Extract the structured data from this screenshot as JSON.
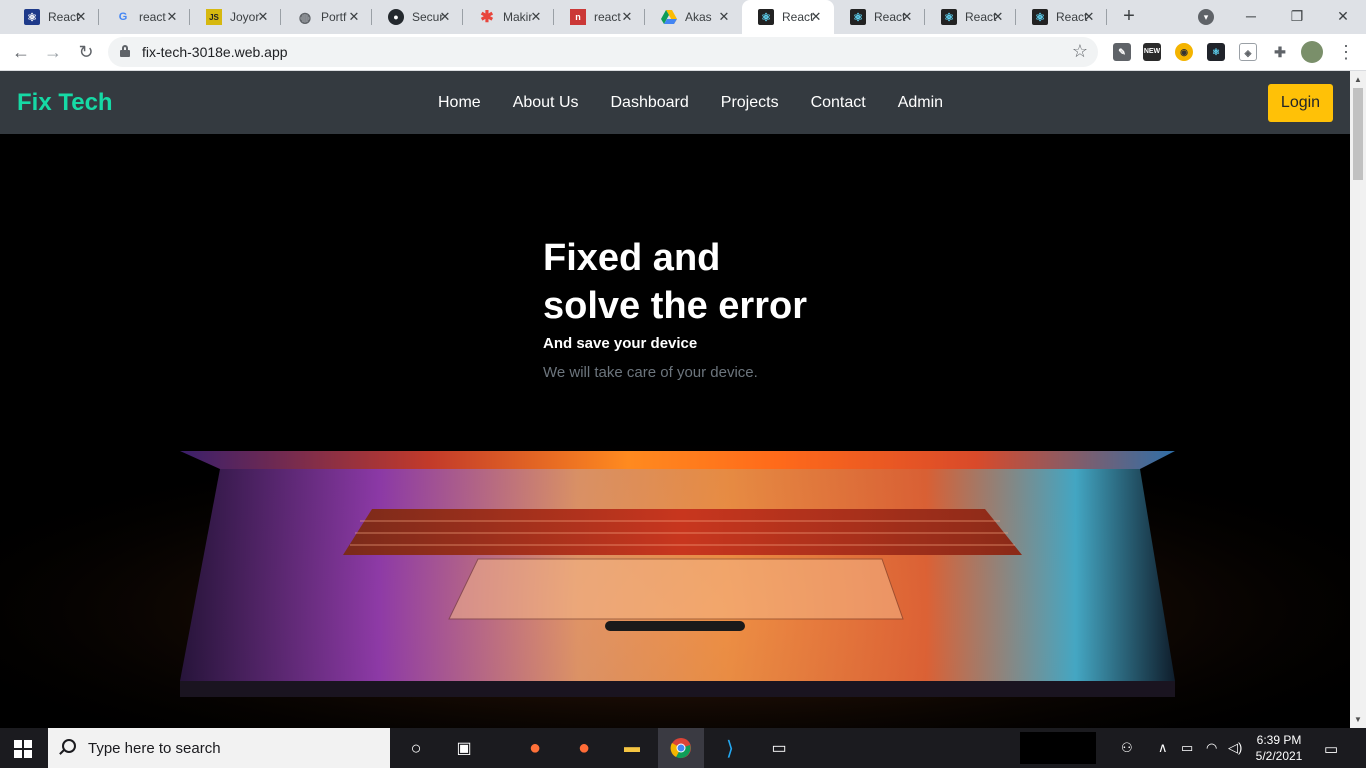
{
  "browser": {
    "tabs": [
      {
        "label": "React",
        "icon": "react-blue-icon",
        "active": false
      },
      {
        "label": "react",
        "icon": "google-icon",
        "active": false
      },
      {
        "label": "Joyor",
        "icon": "jsbin-icon",
        "active": false
      },
      {
        "label": "Portf",
        "icon": "globe-icon",
        "active": false
      },
      {
        "label": "Secur",
        "icon": "github-icon",
        "active": false
      },
      {
        "label": "Makir",
        "icon": "asterisk-icon",
        "active": false
      },
      {
        "label": "react",
        "icon": "npm-icon",
        "active": false
      },
      {
        "label": "Akas",
        "icon": "google-drive-icon",
        "active": false
      },
      {
        "label": "React",
        "icon": "react-icon",
        "active": true
      },
      {
        "label": "React",
        "icon": "react-icon",
        "active": false
      },
      {
        "label": "React",
        "icon": "react-icon",
        "active": false
      },
      {
        "label": "React",
        "icon": "react-icon",
        "active": false
      }
    ],
    "url": "fix-tech-3018e.web.app",
    "extensions": [
      "NEW"
    ]
  },
  "site": {
    "brand": "Fix Tech",
    "nav": [
      "Home",
      "About Us",
      "Dashboard",
      "Projects",
      "Contact",
      "Admin"
    ],
    "login_label": "Login",
    "hero": {
      "title_line1": "Fixed and",
      "title_line2": "solve the error",
      "subtitle": "And save your device",
      "description": "We will take care of your device."
    }
  },
  "taskbar": {
    "search_placeholder": "Type here to search",
    "time": "6:39 PM",
    "date": "5/2/2021"
  },
  "colors": {
    "brand": "#16d9a5",
    "navbar": "#343a40",
    "login_button": "#ffc107"
  }
}
